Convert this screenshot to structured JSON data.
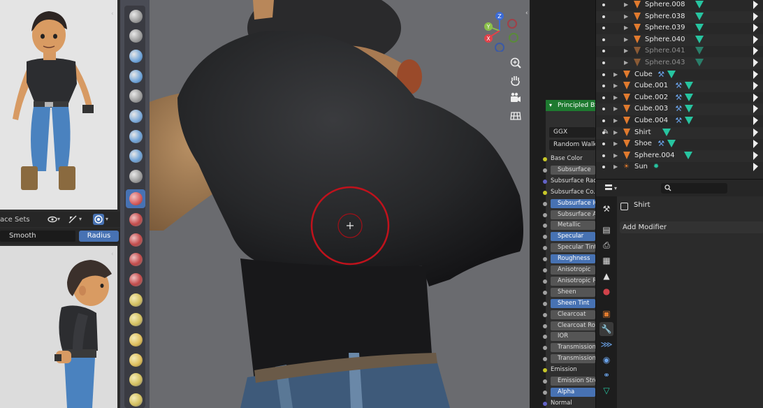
{
  "face_sets_bar": {
    "label": "ace Sets"
  },
  "smooth_bar": {
    "smooth_label": "Smooth",
    "radius_label": "Radius"
  },
  "node": {
    "title": "Principled BSDF",
    "distribution": "GGX",
    "subsurface_method": "Random Walk",
    "inputs": [
      {
        "label": "Base Color",
        "kind": "label",
        "socket": "#c7c729"
      },
      {
        "label": "Subsurface",
        "kind": "field",
        "socket": "#a1a1a1"
      },
      {
        "label": "Subsurface Radius",
        "kind": "label",
        "socket": "#6363c7"
      },
      {
        "label": "Subsurface Co...",
        "kind": "label",
        "socket": "#c7c729"
      },
      {
        "label": "Subsurface IOR",
        "kind": "blue",
        "socket": "#a1a1a1"
      },
      {
        "label": "Subsurface Anisotropy",
        "kind": "field",
        "socket": "#a1a1a1"
      },
      {
        "label": "Metallic",
        "kind": "field",
        "socket": "#a1a1a1"
      },
      {
        "label": "Specular",
        "kind": "blue",
        "socket": "#a1a1a1"
      },
      {
        "label": "Specular Tint",
        "kind": "field",
        "socket": "#a1a1a1"
      },
      {
        "label": "Roughness",
        "kind": "blue",
        "socket": "#a1a1a1"
      },
      {
        "label": "Anisotropic",
        "kind": "field",
        "socket": "#a1a1a1"
      },
      {
        "label": "Anisotropic Rotation",
        "kind": "field",
        "socket": "#a1a1a1"
      },
      {
        "label": "Sheen",
        "kind": "field",
        "socket": "#a1a1a1"
      },
      {
        "label": "Sheen Tint",
        "kind": "blue",
        "socket": "#a1a1a1"
      },
      {
        "label": "Clearcoat",
        "kind": "field",
        "socket": "#a1a1a1"
      },
      {
        "label": "Clearcoat Roughness",
        "kind": "field",
        "socket": "#a1a1a1"
      },
      {
        "label": "IOR",
        "kind": "field",
        "socket": "#a1a1a1"
      },
      {
        "label": "Transmission",
        "kind": "field",
        "socket": "#a1a1a1"
      },
      {
        "label": "Transmission Roughness",
        "kind": "field",
        "socket": "#a1a1a1"
      },
      {
        "label": "Emission",
        "kind": "label",
        "socket": "#c7c729"
      },
      {
        "label": "Emission Strength",
        "kind": "field",
        "socket": "#a1a1a1"
      },
      {
        "label": "Alpha",
        "kind": "blue",
        "socket": "#a1a1a1"
      },
      {
        "label": "Normal",
        "kind": "label",
        "socket": "#6363c7"
      }
    ]
  },
  "outliner": {
    "items": [
      {
        "name": "Sphere.008",
        "type": "mesh",
        "child": true,
        "dim": false,
        "modifier": false
      },
      {
        "name": "Sphere.038",
        "type": "mesh",
        "child": true,
        "dim": false,
        "modifier": false
      },
      {
        "name": "Sphere.039",
        "type": "mesh",
        "child": true,
        "dim": false,
        "modifier": false
      },
      {
        "name": "Sphere.040",
        "type": "mesh",
        "child": true,
        "dim": false,
        "modifier": false
      },
      {
        "name": "Sphere.041",
        "type": "mesh",
        "child": true,
        "dim": true,
        "modifier": false
      },
      {
        "name": "Sphere.043",
        "type": "mesh",
        "child": true,
        "dim": true,
        "modifier": false
      },
      {
        "name": "Cube",
        "type": "mesh",
        "child": false,
        "dim": false,
        "modifier": true
      },
      {
        "name": "Cube.001",
        "type": "mesh",
        "child": false,
        "dim": false,
        "modifier": true
      },
      {
        "name": "Cube.002",
        "type": "mesh",
        "child": false,
        "dim": false,
        "modifier": true
      },
      {
        "name": "Cube.003",
        "type": "mesh",
        "child": false,
        "dim": false,
        "modifier": true
      },
      {
        "name": "Cube.004",
        "type": "mesh",
        "child": false,
        "dim": false,
        "modifier": true
      },
      {
        "name": "Shirt",
        "type": "mesh",
        "child": false,
        "dim": false,
        "modifier": false,
        "selected": true
      },
      {
        "name": "Shoe",
        "type": "mesh",
        "child": false,
        "dim": false,
        "modifier": true
      },
      {
        "name": "Sphere.004",
        "type": "mesh",
        "child": false,
        "dim": false,
        "modifier": false
      },
      {
        "name": "Sun",
        "type": "light",
        "child": false,
        "dim": false,
        "modifier": false
      }
    ]
  },
  "properties": {
    "search_placeholder": "",
    "object_name": "Shirt",
    "add_modifier_label": "Add Modifier"
  },
  "gizmo": {
    "x_label": "X",
    "y_label": "Y",
    "z_label": "Z"
  },
  "colors": {
    "accent_blue": "#4772b3",
    "node_header_green": "#1e7a30",
    "brush_ring_red": "#c0121c",
    "mesh_icon_orange": "#e07a2e",
    "data_icon_teal": "#27c4a0"
  }
}
